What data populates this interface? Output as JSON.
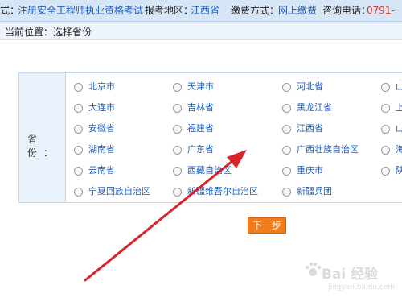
{
  "topbar": {
    "exam_type_label": "式：",
    "exam_type_value": "注册安全工程师执业资格考试",
    "region_label": "报考地区：",
    "region_value": "江西省",
    "payment_label": "缴费方式：",
    "payment_value": "网上缴费",
    "phone_label": "咨询电话：",
    "phone_value": "0791-"
  },
  "location": {
    "text": "当前位置：选择省份"
  },
  "form": {
    "label": "省  份：",
    "provinces": [
      [
        "北京市",
        "天津市",
        "河北省",
        "山"
      ],
      [
        "大连市",
        "吉林省",
        "黑龙江省",
        "上"
      ],
      [
        "安徽省",
        "福建省",
        "江西省",
        "山"
      ],
      [
        "湖南省",
        "广东省",
        "广西壮族自治区",
        "海"
      ],
      [
        "云南省",
        "西藏自治区",
        "重庆市",
        "陕"
      ],
      [
        "宁夏回族自治区",
        "新疆维吾尔自治区",
        "新疆兵团"
      ]
    ]
  },
  "next_button": {
    "label": "下一步"
  },
  "watermark": {
    "text": "Bai 经验",
    "sub": "jingyan.baidu.com"
  },
  "colors": {
    "arrow": "#d8232a",
    "button": "#f07c1c",
    "link": "#1e5db8",
    "header_bg": "#d7e6f7"
  }
}
